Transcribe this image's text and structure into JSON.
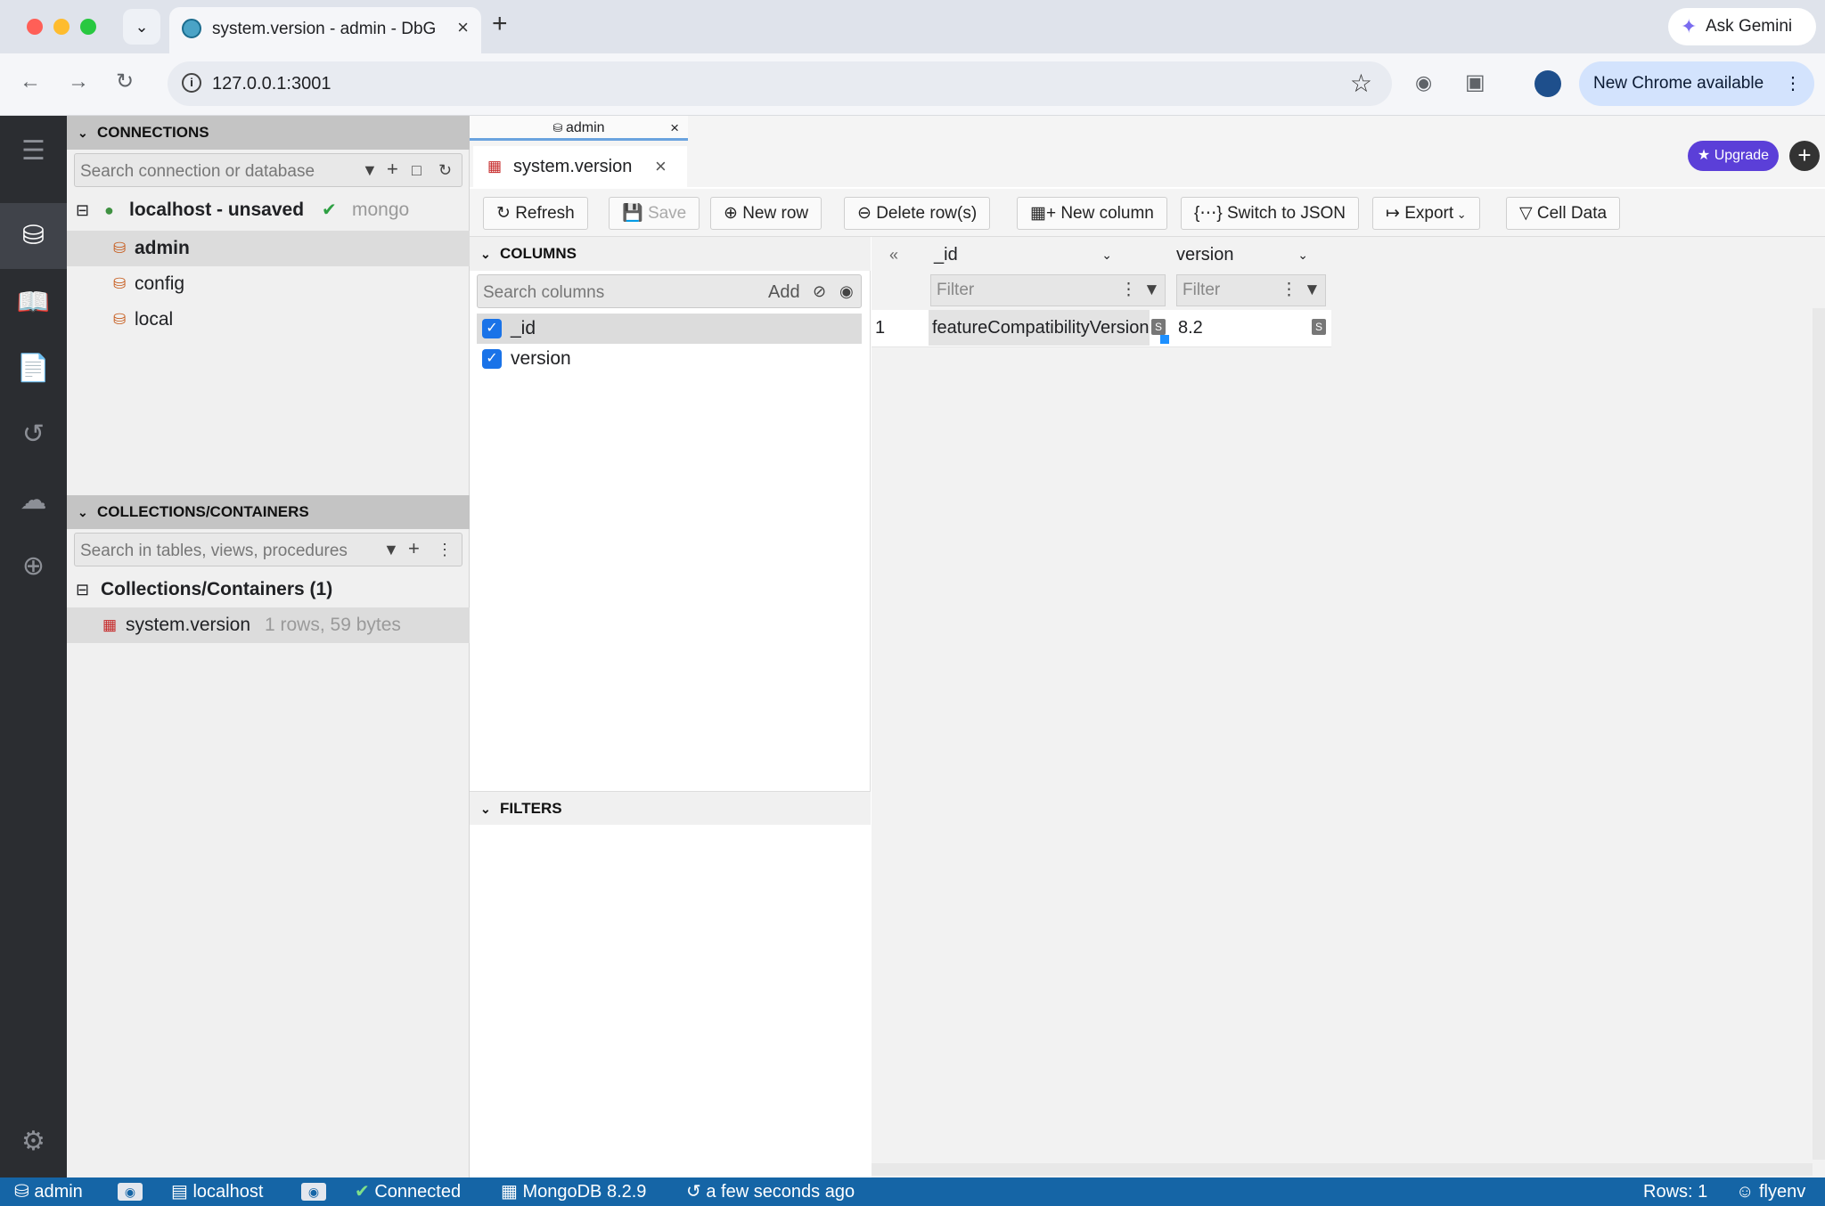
{
  "browser": {
    "tab_title": "system.version - admin - DbGate",
    "url": "127.0.0.1:3001",
    "ask_gemini": "Ask Gemini",
    "update_label": "New Chrome available"
  },
  "connections": {
    "header": "CONNECTIONS",
    "search_placeholder": "Search connection or database",
    "server_name": "localhost - unsaved",
    "server_engine": "mongo",
    "databases": [
      "admin",
      "config",
      "local"
    ]
  },
  "collections": {
    "header": "COLLECTIONS/CONTAINERS",
    "search_placeholder": "Search in tables, views, procedures",
    "group_label": "Collections/Containers (1)",
    "items": [
      {
        "name": "system.version",
        "info": "1 rows, 59 bytes"
      }
    ]
  },
  "tabs": {
    "connection_tab": "admin",
    "doc_tab": "system.version",
    "upgrade": "Upgrade"
  },
  "actions": {
    "refresh": "Refresh",
    "save": "Save",
    "new_row": "New row",
    "delete_rows": "Delete row(s)",
    "new_column": "New column",
    "switch_json": "Switch to JSON",
    "export": "Export",
    "cell_data": "Cell Data"
  },
  "columns_panel": {
    "header": "COLUMNS",
    "search_placeholder": "Search columns",
    "add_label": "Add",
    "items": [
      "_id",
      "version"
    ],
    "filters_header": "FILTERS"
  },
  "grid": {
    "columns": [
      "_id",
      "version"
    ],
    "filter_placeholder": "Filter",
    "rows": [
      {
        "num": "1",
        "id": "featureCompatibilityVersion",
        "version": "8.2"
      }
    ]
  },
  "status": {
    "database": "admin",
    "server": "localhost",
    "connection": "Connected",
    "engine": "MongoDB 8.2.9",
    "updated": "a few seconds ago",
    "rows": "Rows: 1",
    "user": "flyenv"
  }
}
